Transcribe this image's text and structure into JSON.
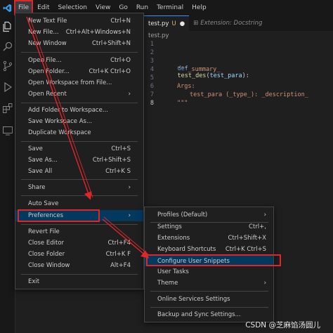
{
  "menubar": {
    "items": [
      "File",
      "Edit",
      "Selection",
      "View",
      "Go",
      "Run",
      "Terminal",
      "Help"
    ]
  },
  "editor": {
    "tabs": [
      {
        "label": "test.py",
        "modified": "U",
        "dot": "●"
      },
      {
        "label": "Extension: Docstring"
      }
    ],
    "breadcrumb": "test.py",
    "line_numbers": [
      "1",
      "2",
      "3",
      "4",
      "5",
      "6",
      "7",
      "8"
    ],
    "code": {
      "line3_kw": "def",
      "line3_fn": "test_des",
      "line3_param": "test_para",
      "line4": "\"\"\"_summary_",
      "line6": "Args:",
      "line7": "test_para (_type_): _description_",
      "line8": "\"\"\""
    }
  },
  "file_menu": {
    "items": [
      {
        "label": "New Text File",
        "shortcut": "Ctrl+N"
      },
      {
        "label": "New File...",
        "shortcut": "Ctrl+Alt+Windows+N"
      },
      {
        "label": "New Window",
        "shortcut": "Ctrl+Shift+N"
      },
      {
        "label": "Open File...",
        "shortcut": "Ctrl+O"
      },
      {
        "label": "Open Folder...",
        "shortcut": "Ctrl+K Ctrl+O"
      },
      {
        "label": "Open Workspace from File...",
        "shortcut": ""
      },
      {
        "label": "Open Recent",
        "shortcut": "›"
      },
      {
        "label": "Add Folder to Workspace...",
        "shortcut": ""
      },
      {
        "label": "Save Workspace As...",
        "shortcut": ""
      },
      {
        "label": "Duplicate Workspace",
        "shortcut": ""
      },
      {
        "label": "Save",
        "shortcut": "Ctrl+S"
      },
      {
        "label": "Save As...",
        "shortcut": "Ctrl+Shift+S"
      },
      {
        "label": "Save All",
        "shortcut": "Ctrl+K S"
      },
      {
        "label": "Share",
        "shortcut": "›"
      },
      {
        "label": "Auto Save",
        "shortcut": ""
      },
      {
        "label": "Preferences",
        "shortcut": "›"
      },
      {
        "label": "Revert File",
        "shortcut": ""
      },
      {
        "label": "Close Editor",
        "shortcut": "Ctrl+F4"
      },
      {
        "label": "Close Folder",
        "shortcut": "Ctrl+K F"
      },
      {
        "label": "Close Window",
        "shortcut": "Alt+F4"
      },
      {
        "label": "Exit",
        "shortcut": ""
      }
    ]
  },
  "preferences_menu": {
    "items": [
      {
        "label": "Profiles (Default)",
        "shortcut": "›"
      },
      {
        "label": "Settings",
        "shortcut": "Ctrl+,"
      },
      {
        "label": "Extensions",
        "shortcut": "Ctrl+Shift+X"
      },
      {
        "label": "Keyboard Shortcuts",
        "shortcut": "Ctrl+K Ctrl+S"
      },
      {
        "label": "Configure User Snippets",
        "shortcut": ""
      },
      {
        "label": "User Tasks",
        "shortcut": ""
      },
      {
        "label": "Theme",
        "shortcut": "›"
      },
      {
        "label": "Online Services Settings",
        "shortcut": ""
      },
      {
        "label": "Backup and Sync Settings...",
        "shortcut": ""
      }
    ]
  },
  "watermark": "CSDN @芝麻馅汤圆儿",
  "colors": {
    "annotation_red": "#e0262b",
    "highlight": "#04395e",
    "accent": "#3794ff"
  }
}
